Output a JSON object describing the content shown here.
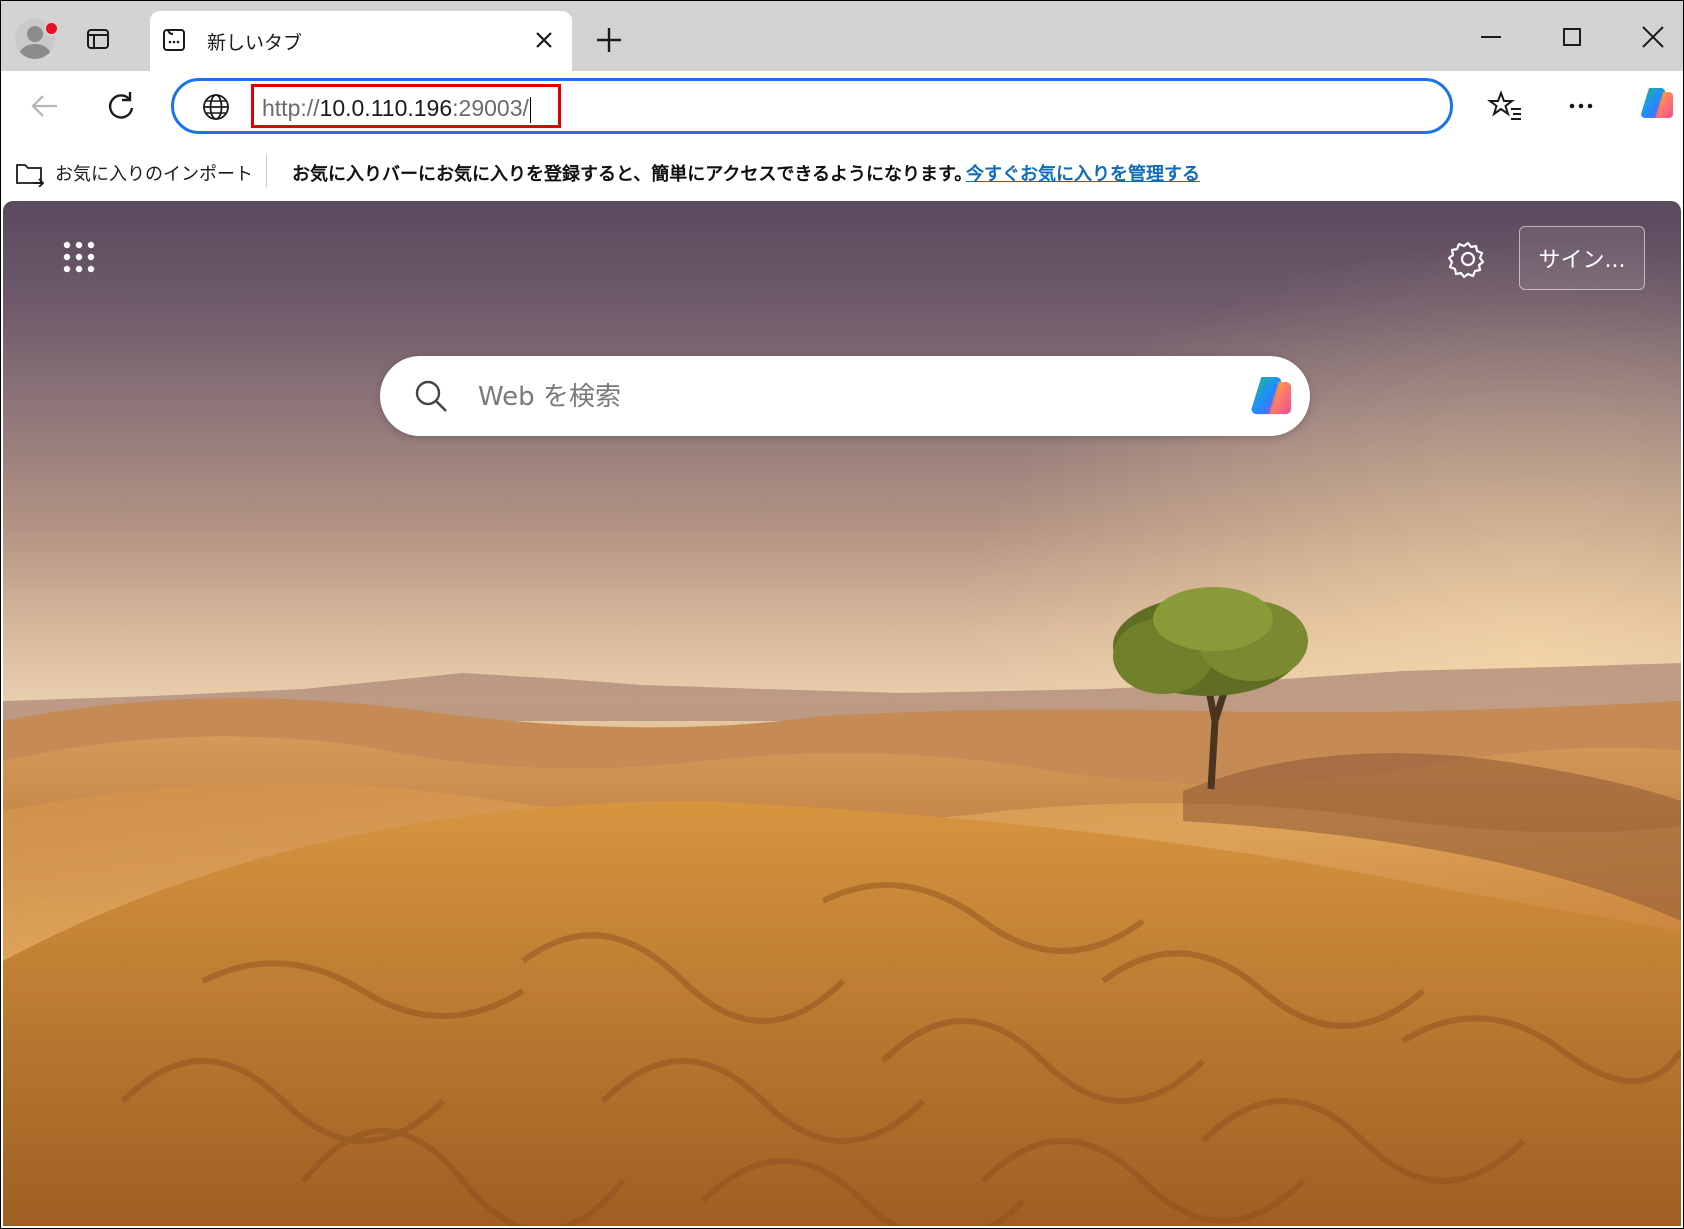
{
  "tab": {
    "title": "新しいタブ"
  },
  "address": {
    "proto": "http://",
    "host": "10.0.110.196",
    "port": ":29003/"
  },
  "favorites_bar": {
    "import_label": "お気に入りのインポート",
    "message": "お気に入りバーにお気に入りを登録すると、簡単にアクセスできるようになります。",
    "manage_link": "今すぐお気に入りを管理する"
  },
  "new_tab_page": {
    "signin_label": "サイン...",
    "search_placeholder": "Web を検索"
  },
  "colors": {
    "address_border": "#1a73e8",
    "highlight_box": "#e00000",
    "link": "#0f6cbd",
    "notification_dot": "#e81123"
  }
}
